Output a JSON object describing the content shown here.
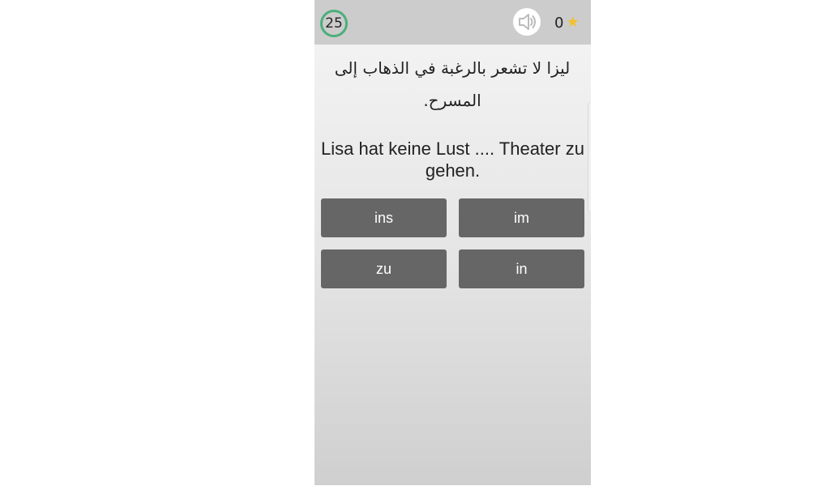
{
  "header": {
    "timer": "25",
    "score": "0",
    "sound_icon": "speaker-icon",
    "score_icon": "star-icon",
    "timer_color": "#4caf7a",
    "star_color": "#f2c12e"
  },
  "question": {
    "arabic": "ليزا لا تشعر بالرغبة في الذهاب إلى المسرح.",
    "german": "Lisa hat keine Lust .... Theater zu gehen."
  },
  "answers": [
    {
      "label": "ins"
    },
    {
      "label": "im"
    },
    {
      "label": "zu"
    },
    {
      "label": "in"
    }
  ],
  "colors": {
    "answer_bg": "#666666",
    "topbar_bg": "#cccccc"
  }
}
